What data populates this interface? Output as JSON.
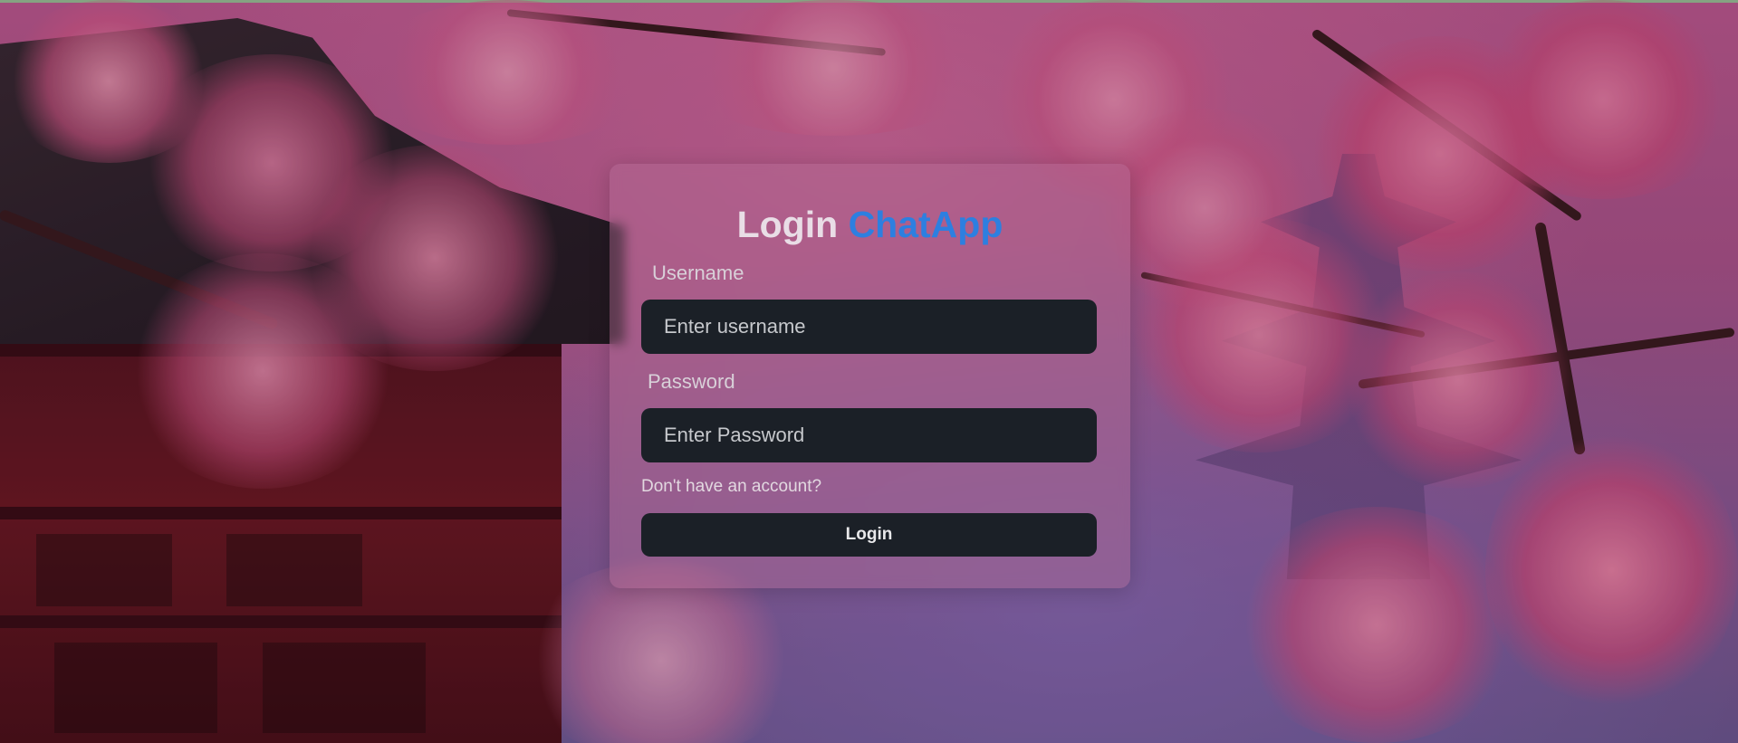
{
  "login_card": {
    "title": "Login",
    "brand": "ChatApp",
    "username_label": "Username",
    "username_placeholder": "Enter username",
    "username_value": "",
    "password_label": "Password",
    "password_placeholder": "Enter Password",
    "password_value": "",
    "signup_link": "Don't have an account?",
    "login_button": "Login"
  },
  "colors": {
    "brand": "#2d7fe0",
    "input_bg": "#1b2027",
    "title_text": "#e9dde6"
  }
}
